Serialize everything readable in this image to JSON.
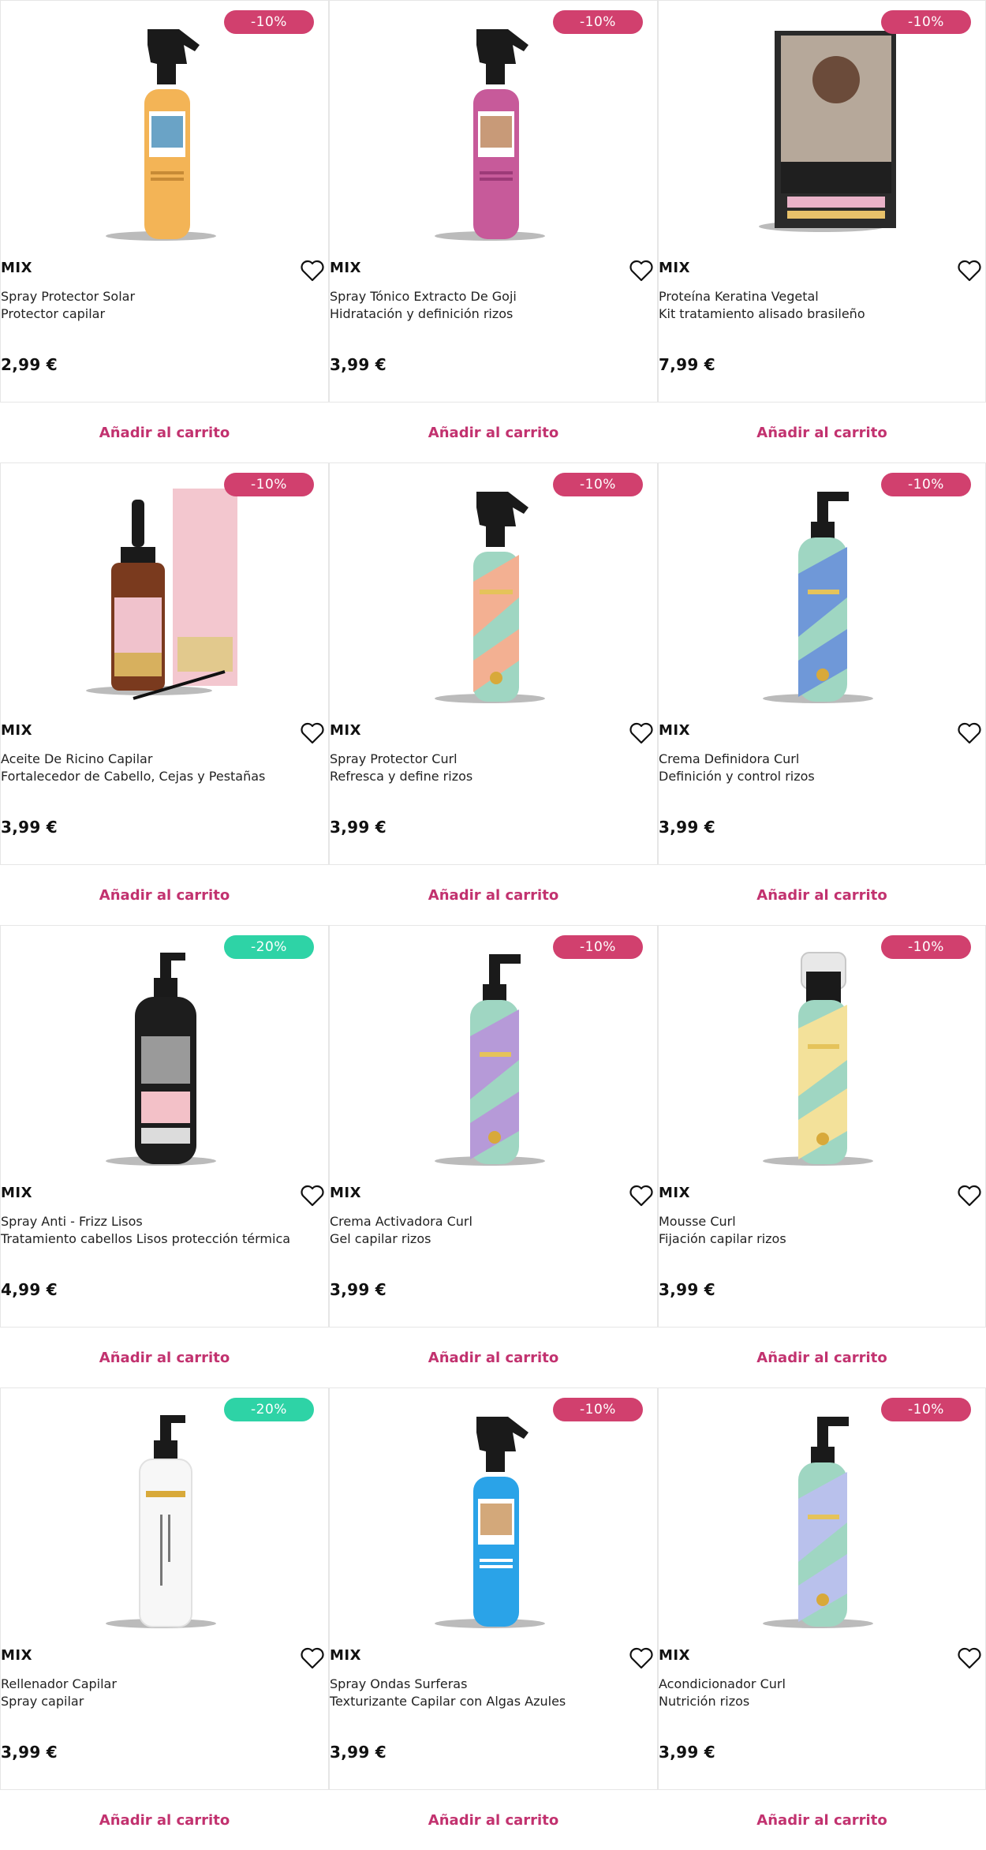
{
  "colors": {
    "accent": "#c2326f",
    "badge_pink": "#d1406e",
    "badge_green": "#2ed3a6"
  },
  "products": [
    {
      "brand": "MIX",
      "name": "Spray Protector Solar",
      "subtitle": "Protector capilar",
      "price": "2,99 €",
      "discount": "-10%",
      "badge": "pink",
      "image": "spray-bottle-orange",
      "cart_label": "Añadir al carrito"
    },
    {
      "brand": "MIX",
      "name": "Spray Tónico Extracto De Goji",
      "subtitle": "Hidratación y definición rizos",
      "price": "3,99 €",
      "discount": "-10%",
      "badge": "pink",
      "image": "spray-bottle-magenta",
      "cart_label": "Añadir al carrito"
    },
    {
      "brand": "MIX",
      "name": "Proteína Keratina Vegetal",
      "subtitle": "Kit tratamiento alisado brasileño",
      "price": "7,99 €",
      "discount": "-10%",
      "badge": "pink",
      "image": "keratine-treatment-box",
      "cart_label": "Añadir al carrito"
    },
    {
      "brand": "MIX",
      "name": "Aceite De Ricino Capilar",
      "subtitle": "Fortalecedor de Cabello, Cejas y Pestañas",
      "price": "3,99 €",
      "discount": "-10%",
      "badge": "pink",
      "image": "castor-oil-dropper-box",
      "cart_label": "Añadir al carrito"
    },
    {
      "brand": "MIX",
      "name": "Spray Protector Curl",
      "subtitle": "Refresca y define rizos",
      "price": "3,99 €",
      "discount": "-10%",
      "badge": "pink",
      "image": "spray-bottle-curl-peach",
      "cart_label": "Añadir al carrito"
    },
    {
      "brand": "MIX",
      "name": "Crema Definidora Curl",
      "subtitle": "Definición y control rizos",
      "price": "3,99 €",
      "discount": "-10%",
      "badge": "pink",
      "image": "pump-bottle-mint-blue",
      "cart_label": "Añadir al carrito"
    },
    {
      "brand": "MIX",
      "name": "Spray Anti - Frizz Lisos",
      "subtitle": "Tratamiento cabellos Lisos protección térmica",
      "price": "4,99 €",
      "discount": "-20%",
      "badge": "green",
      "image": "anti-frizz-black-bottle",
      "cart_label": "Añadir al carrito"
    },
    {
      "brand": "MIX",
      "name": "Crema Activadora Curl",
      "subtitle": "Gel capilar rizos",
      "price": "3,99 €",
      "discount": "-10%",
      "badge": "pink",
      "image": "pump-bottle-mint-purple",
      "cart_label": "Añadir al carrito"
    },
    {
      "brand": "MIX",
      "name": "Mousse Curl",
      "subtitle": "Fijación capilar rizos",
      "price": "3,99 €",
      "discount": "-10%",
      "badge": "pink",
      "image": "mousse-bottle-mint-yellow",
      "cart_label": "Añadir al carrito"
    },
    {
      "brand": "MIX",
      "name": "Rellenador Capilar",
      "subtitle": "Spray capilar",
      "price": "3,99 €",
      "discount": "-20%",
      "badge": "green",
      "image": "white-spray-bottle",
      "cart_label": "Añadir al carrito"
    },
    {
      "brand": "MIX",
      "name": "Spray Ondas Surferas",
      "subtitle": "Texturizante Capilar con Algas Azules",
      "price": "3,99 €",
      "discount": "-10%",
      "badge": "pink",
      "image": "spray-bottle-blue",
      "cart_label": "Añadir al carrito"
    },
    {
      "brand": "MIX",
      "name": "Acondicionador Curl",
      "subtitle": "Nutrición rizos",
      "price": "3,99 €",
      "discount": "-10%",
      "badge": "pink",
      "image": "pump-bottle-mint-lavender",
      "cart_label": "Añadir al carrito"
    }
  ]
}
